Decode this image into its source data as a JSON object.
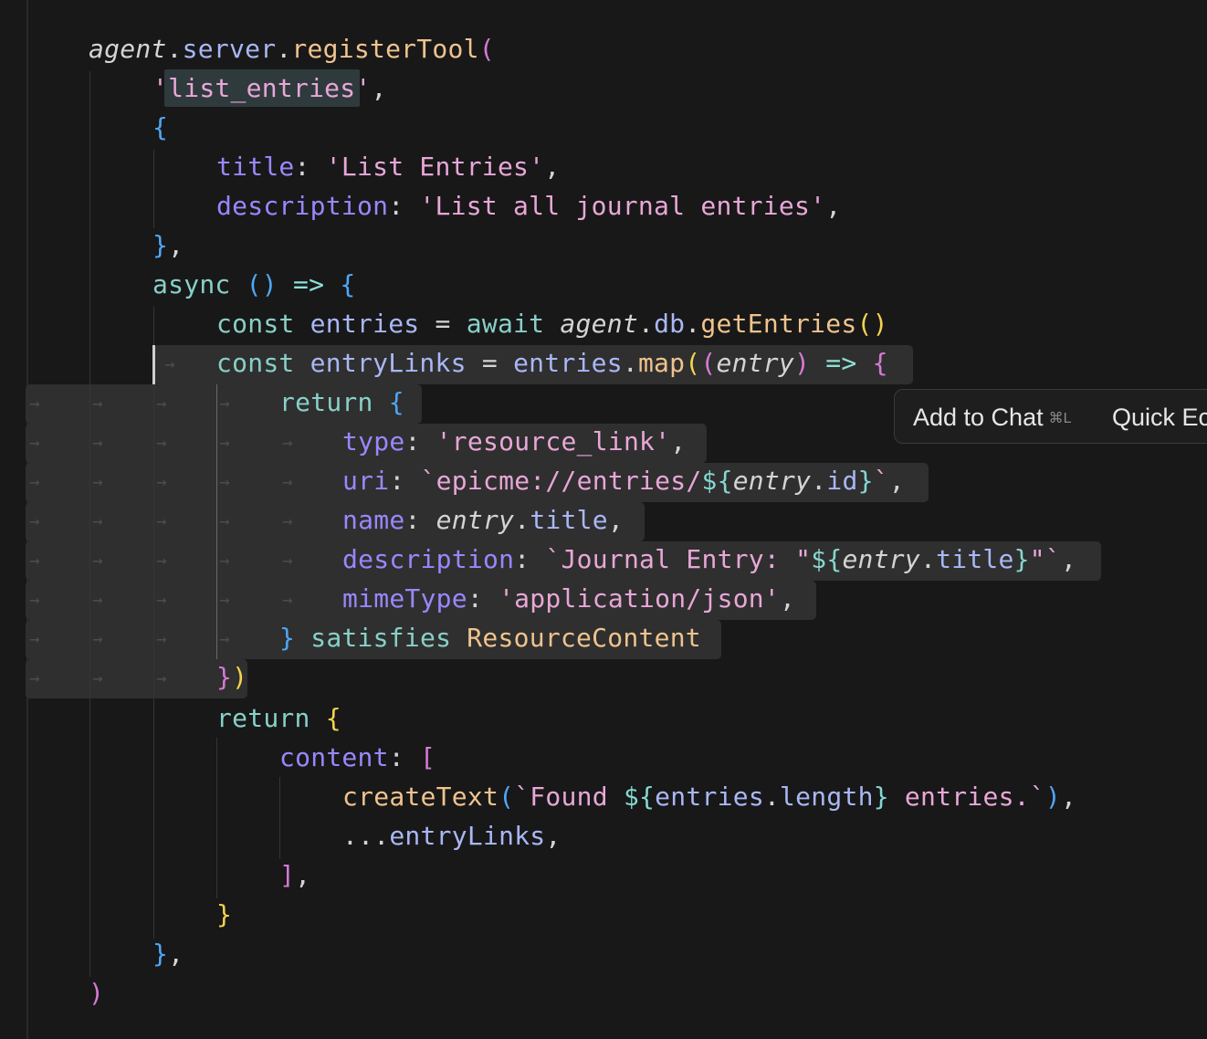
{
  "editor": {
    "language": "typescript",
    "lines": [
      {
        "tokens": [
          [
            "agent",
            "c-italic"
          ],
          [
            ".",
            "c-punct"
          ],
          [
            "server",
            "c-var"
          ],
          [
            ".",
            "c-punct"
          ],
          [
            "registerTool",
            "c-fn"
          ],
          [
            "(",
            "c-paren-p"
          ]
        ]
      },
      {
        "tokens": [
          [
            "'",
            "c-str"
          ],
          [
            "list_entries",
            "c-str"
          ],
          [
            "'",
            "c-str"
          ],
          [
            ",",
            "c-punct"
          ]
        ]
      },
      {
        "tokens": [
          [
            "{",
            "c-paren-b"
          ]
        ]
      },
      {
        "tokens": [
          [
            "title",
            "c-key"
          ],
          [
            ": ",
            "c-punct"
          ],
          [
            "'List Entries'",
            "c-str"
          ],
          [
            ",",
            "c-punct"
          ]
        ]
      },
      {
        "tokens": [
          [
            "description",
            "c-key"
          ],
          [
            ": ",
            "c-punct"
          ],
          [
            "'List all journal entries'",
            "c-str"
          ],
          [
            ",",
            "c-punct"
          ]
        ]
      },
      {
        "tokens": [
          [
            "}",
            "c-paren-b"
          ],
          [
            ",",
            "c-punct"
          ]
        ]
      },
      {
        "tokens": [
          [
            "async ",
            "c-kw"
          ],
          [
            "()",
            "c-paren-b"
          ],
          [
            " => ",
            "c-op"
          ],
          [
            "{",
            "c-paren-b"
          ]
        ]
      },
      {
        "tokens": [
          [
            "const ",
            "c-kw"
          ],
          [
            "entries",
            "c-var"
          ],
          [
            " = ",
            "c-punct"
          ],
          [
            "await ",
            "c-kw"
          ],
          [
            "agent",
            "c-italic"
          ],
          [
            ".",
            "c-punct"
          ],
          [
            "db",
            "c-var"
          ],
          [
            ".",
            "c-punct"
          ],
          [
            "getEntries",
            "c-fn"
          ],
          [
            "()",
            "c-paren-y"
          ]
        ]
      },
      {
        "tokens": [
          [
            "const ",
            "c-kw"
          ],
          [
            "entryLinks",
            "c-var"
          ],
          [
            " = ",
            "c-punct"
          ],
          [
            "entries",
            "c-var"
          ],
          [
            ".",
            "c-punct"
          ],
          [
            "map",
            "c-fn"
          ],
          [
            "(",
            "c-paren-y"
          ],
          [
            "(",
            "c-paren-p"
          ],
          [
            "entry",
            "c-italic"
          ],
          [
            ")",
            "c-paren-p"
          ],
          [
            " => ",
            "c-op"
          ],
          [
            "{",
            "c-paren-p"
          ]
        ]
      },
      {
        "tokens": [
          [
            "return ",
            "c-kw"
          ],
          [
            "{",
            "c-paren-b"
          ]
        ]
      },
      {
        "tokens": [
          [
            "type",
            "c-key"
          ],
          [
            ": ",
            "c-punct"
          ],
          [
            "'resource_link'",
            "c-str"
          ],
          [
            ",",
            "c-punct"
          ]
        ]
      },
      {
        "tokens": [
          [
            "uri",
            "c-key"
          ],
          [
            ": ",
            "c-punct"
          ],
          [
            "`epicme://entries/",
            "c-tpl"
          ],
          [
            "${",
            "c-interp"
          ],
          [
            "entry",
            "c-italic"
          ],
          [
            ".",
            "c-punct"
          ],
          [
            "id",
            "c-var"
          ],
          [
            "}",
            "c-interp"
          ],
          [
            "`",
            "c-tpl"
          ],
          [
            ",",
            "c-punct"
          ]
        ]
      },
      {
        "tokens": [
          [
            "name",
            "c-key"
          ],
          [
            ": ",
            "c-punct"
          ],
          [
            "entry",
            "c-italic"
          ],
          [
            ".",
            "c-punct"
          ],
          [
            "title",
            "c-var"
          ],
          [
            ",",
            "c-punct"
          ]
        ]
      },
      {
        "tokens": [
          [
            "description",
            "c-key"
          ],
          [
            ": ",
            "c-punct"
          ],
          [
            "`Journal Entry: \"",
            "c-tpl"
          ],
          [
            "${",
            "c-interp"
          ],
          [
            "entry",
            "c-italic"
          ],
          [
            ".",
            "c-punct"
          ],
          [
            "title",
            "c-var"
          ],
          [
            "}",
            "c-interp"
          ],
          [
            "\"`",
            "c-tpl"
          ],
          [
            ",",
            "c-punct"
          ]
        ]
      },
      {
        "tokens": [
          [
            "mimeType",
            "c-key"
          ],
          [
            ": ",
            "c-punct"
          ],
          [
            "'application/json'",
            "c-str"
          ],
          [
            ",",
            "c-punct"
          ]
        ]
      },
      {
        "tokens": [
          [
            "}",
            "c-paren-b"
          ],
          [
            " satisfies ",
            "c-kw"
          ],
          [
            "ResourceContent",
            "c-type"
          ]
        ]
      },
      {
        "tokens": [
          [
            "}",
            "c-paren-p"
          ],
          [
            ")",
            "c-paren-y"
          ]
        ]
      },
      {
        "tokens": [
          [
            "return ",
            "c-kw"
          ],
          [
            "{",
            "c-paren-y"
          ]
        ]
      },
      {
        "tokens": [
          [
            "content",
            "c-key"
          ],
          [
            ": ",
            "c-punct"
          ],
          [
            "[",
            "c-paren-p"
          ]
        ]
      },
      {
        "tokens": [
          [
            "createText",
            "c-fn"
          ],
          [
            "(",
            "c-paren-b"
          ],
          [
            "`Found ",
            "c-tpl"
          ],
          [
            "${",
            "c-interp"
          ],
          [
            "entries",
            "c-var"
          ],
          [
            ".",
            "c-punct"
          ],
          [
            "length",
            "c-var"
          ],
          [
            "}",
            "c-interp"
          ],
          [
            " entries.`",
            "c-tpl"
          ],
          [
            ")",
            "c-paren-b"
          ],
          [
            ",",
            "c-punct"
          ]
        ]
      },
      {
        "tokens": [
          [
            "...",
            "c-punct"
          ],
          [
            "entryLinks",
            "c-var"
          ],
          [
            ",",
            "c-punct"
          ]
        ]
      },
      {
        "tokens": [
          [
            "]",
            "c-paren-p"
          ],
          [
            ",",
            "c-punct"
          ]
        ]
      },
      {
        "tokens": [
          [
            "}",
            "c-paren-y"
          ]
        ]
      },
      {
        "tokens": [
          [
            "}",
            "c-paren-b"
          ],
          [
            ",",
            "c-punct"
          ]
        ]
      },
      {
        "tokens": [
          [
            ")",
            "c-paren-p"
          ]
        ]
      }
    ],
    "whitespace_glyph": "→"
  },
  "context_menu": {
    "add_to_chat_label": "Add to Chat",
    "add_to_chat_shortcut": "⌘L",
    "quick_edit_label": "Quick Ec"
  }
}
